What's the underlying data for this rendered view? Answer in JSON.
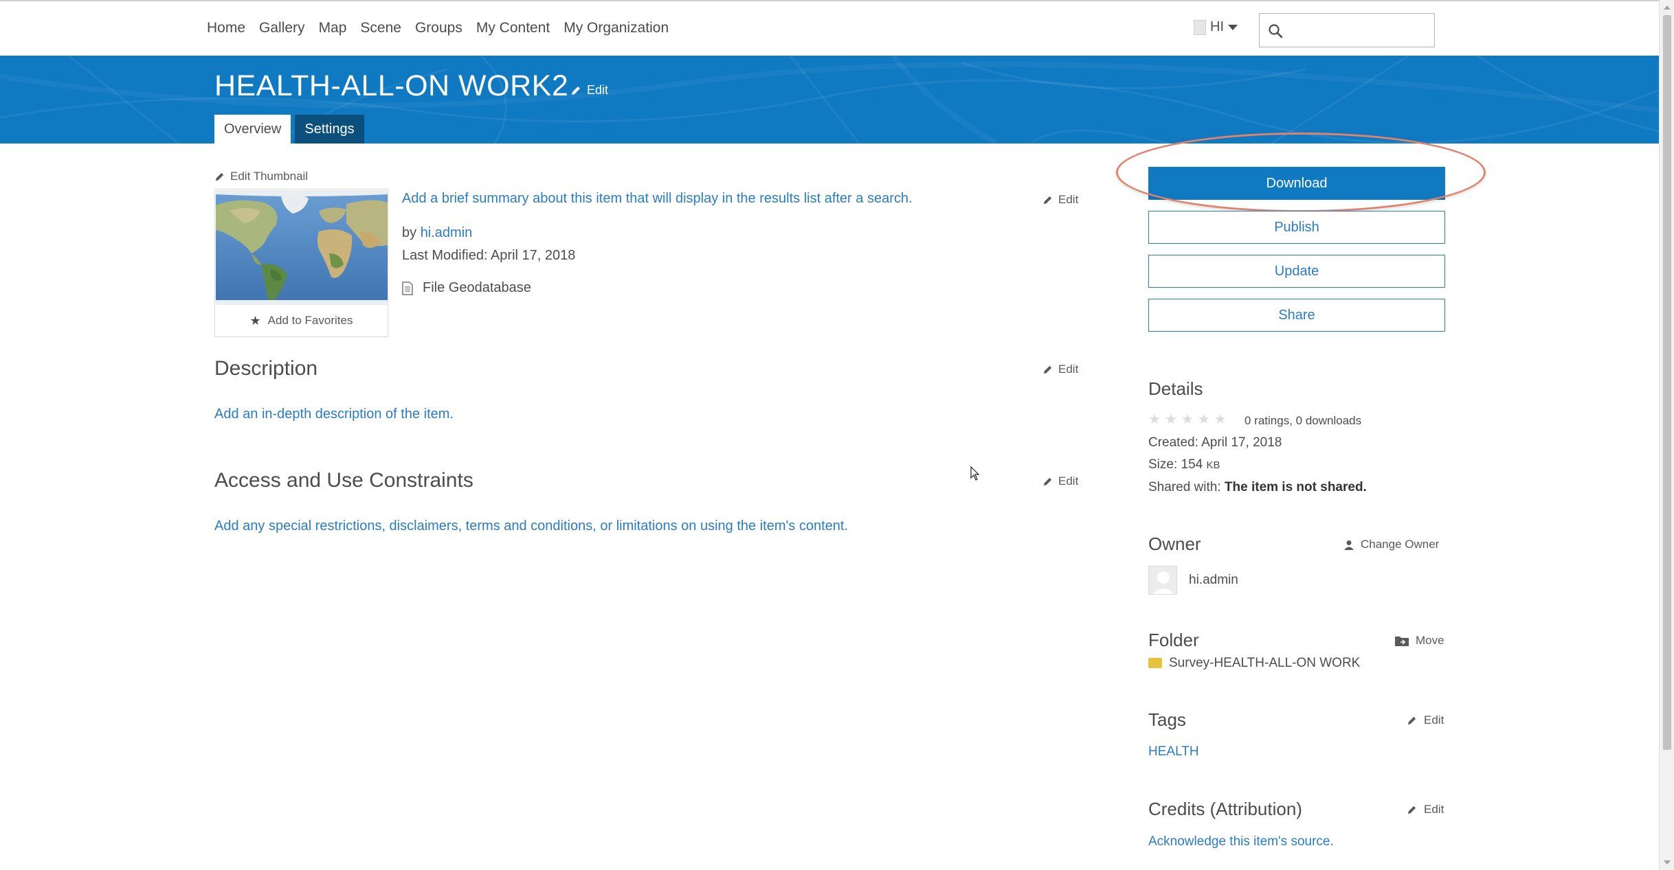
{
  "nav": {
    "items": [
      "Home",
      "Gallery",
      "Map",
      "Scene",
      "Groups",
      "My Content",
      "My Organization"
    ],
    "user_label": "HI",
    "search_placeholder": ""
  },
  "banner": {
    "title": "HEALTH-ALL-ON WORK2",
    "edit_label": "Edit",
    "tabs": [
      {
        "label": "Overview",
        "active": true
      },
      {
        "label": "Settings",
        "active": false
      }
    ]
  },
  "item": {
    "edit_thumbnail": "Edit Thumbnail",
    "add_favorites": "Add to Favorites",
    "summary": "Add a brief summary about this item that will display in the results list after a search.",
    "by_prefix": "by",
    "owner_link": "hi.admin",
    "last_modified": "Last Modified: April 17, 2018",
    "file_type": "File Geodatabase",
    "edit_label": "Edit"
  },
  "sections": {
    "description": {
      "title": "Description",
      "body": "Add an in-depth description of the item.",
      "edit": "Edit"
    },
    "constraints": {
      "title": "Access and Use Constraints",
      "body": "Add any special restrictions, disclaimers, terms and conditions, or limitations on using the item's content.",
      "edit": "Edit"
    }
  },
  "actions": {
    "download": "Download",
    "publish": "Publish",
    "update": "Update",
    "share": "Share"
  },
  "details": {
    "title": "Details",
    "ratings": "0 ratings, 0 downloads",
    "created": "Created: April 17, 2018",
    "size_label": "Size: 154",
    "size_unit": "KB",
    "shared_label": "Shared with:",
    "shared_value": "The item is not shared.",
    "rating_value": 0,
    "rating_max": 5
  },
  "owner": {
    "title": "Owner",
    "change_label": "Change Owner",
    "name": "hi.admin"
  },
  "folder": {
    "title": "Folder",
    "move_label": "Move",
    "name": "Survey-HEALTH-ALL-ON WORK"
  },
  "tags": {
    "title": "Tags",
    "edit": "Edit",
    "items": [
      "HEALTH"
    ]
  },
  "credits": {
    "title": "Credits (Attribution)",
    "edit": "Edit",
    "body": "Acknowledge this item's source."
  },
  "colors": {
    "brand_blue": "#0f79c2",
    "link_blue": "#2a7cc2",
    "tab_dark": "#0b4f7d",
    "highlight": "#e0836b"
  }
}
